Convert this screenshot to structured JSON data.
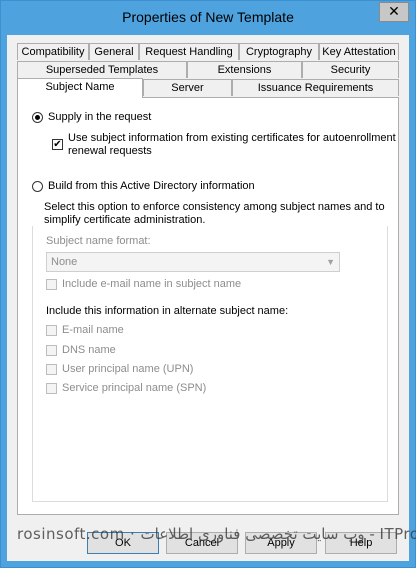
{
  "window": {
    "title": "Properties of New Template",
    "close_glyph": "✕"
  },
  "tabs": {
    "row1": [
      "Compatibility",
      "General",
      "Request Handling",
      "Cryptography",
      "Key Attestation"
    ],
    "row2": [
      "Superseded Templates",
      "Extensions",
      "Security"
    ],
    "row3": [
      "Subject Name",
      "Server",
      "Issuance Requirements"
    ],
    "active": "Subject Name"
  },
  "subject": {
    "supply_label": "Supply in the request",
    "supply_selected": true,
    "use_existing_line1": "Use subject information from existing certificates for autoenrollment",
    "use_existing_line2": "renewal requests",
    "use_existing_checked": true,
    "build_label": "Build from this Active Directory information",
    "build_selected": false,
    "description_line1": "Select this option to enforce consistency among subject names and to",
    "description_line2": "simplify certificate administration.",
    "format_label": "Subject name format:",
    "format_value": "None",
    "include_email_label": "Include e-mail name in subject name",
    "alt_label": "Include this information in alternate subject name:",
    "alt_options": [
      "E-mail name",
      "DNS name",
      "User principal name (UPN)",
      "Service principal name (SPN)"
    ]
  },
  "buttons": {
    "ok": "OK",
    "cancel": "Cancel",
    "apply": "Apply",
    "help": "Help"
  },
  "watermark": "rosinsoft.com  ·  وب سایت تخصصی فناوری اطلاعات  -  ITPro.ir"
}
